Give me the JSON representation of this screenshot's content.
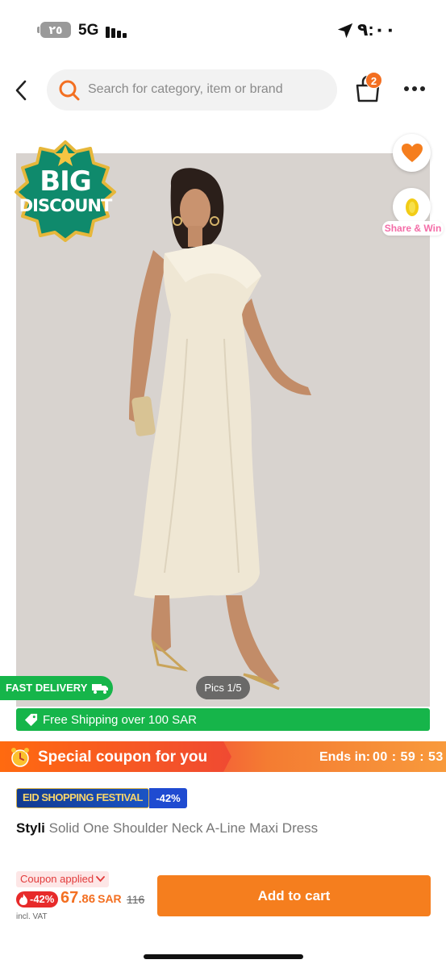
{
  "status_bar": {
    "battery": "٢٥",
    "network": "5G",
    "time": "٩:٠٠",
    "icons": [
      "signal-bars-icon",
      "location-arrow-icon"
    ]
  },
  "nav": {
    "back_icon": "chevron-left-icon",
    "search_placeholder": "Search for category, item or brand",
    "cart_count": "2",
    "more_icon": "more-horizontal-icon"
  },
  "product_image": {
    "badge_line1": "BIG",
    "badge_line2": "DISCOUNT",
    "share_label": "Share & Win",
    "fast_delivery": "FAST DELIVERY",
    "pics_counter": "Pics 1/5"
  },
  "free_shipping": "Free Shipping over 100 SAR",
  "coupon": {
    "title": "Special coupon for you",
    "ends_label": "Ends in:",
    "countdown": "00 : 59 : 53"
  },
  "promo": {
    "eid_label": "EID SHOPPING FESTIVAL",
    "eid_discount": "-42%"
  },
  "product": {
    "brand": "Styli",
    "name": "Solid One Shoulder Neck A-Line Maxi Dress"
  },
  "price": {
    "coupon_applied": "Coupon applied",
    "discount": "-42%",
    "integer": "67",
    "decimal": ".86",
    "currency": "SAR",
    "old": "116",
    "vat": "incl. VAT"
  },
  "actions": {
    "add_to_cart": "Add to cart"
  },
  "colors": {
    "brand_orange": "#f36f21",
    "green": "#16b54a",
    "sale_red": "#e72a2a"
  }
}
